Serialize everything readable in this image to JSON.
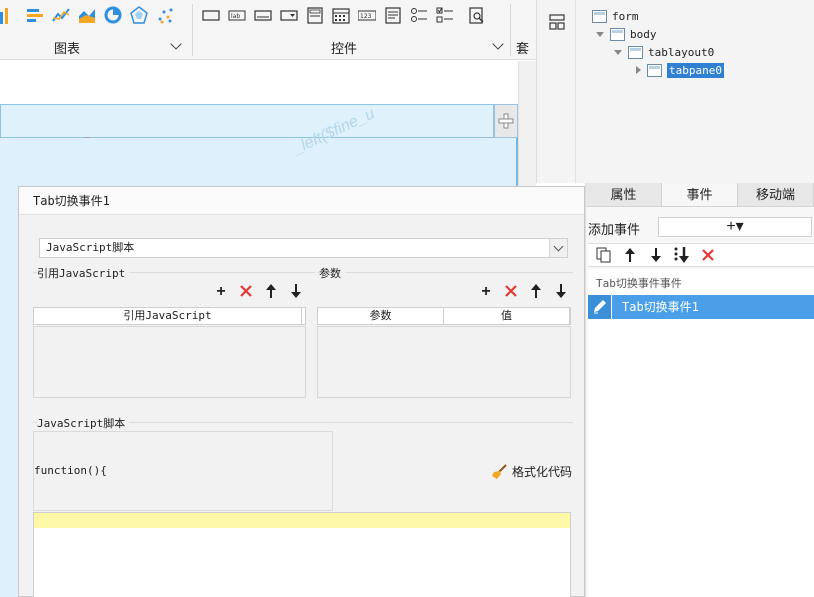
{
  "toolbar": {
    "chart_group_label": "图表",
    "widget_group_label": "控件",
    "partial_label": "套用"
  },
  "canvas": {
    "watermark": "_left($fine_u"
  },
  "tree": {
    "nodes": [
      {
        "label": "form"
      },
      {
        "label": "body"
      },
      {
        "label": "tablayout0"
      },
      {
        "label": "tabpane0"
      }
    ]
  },
  "props": {
    "tabs": [
      {
        "label": "属性"
      },
      {
        "label": "事件"
      },
      {
        "label": "移动端"
      }
    ],
    "add_event_label": "添加事件",
    "add_event_button": "+▾",
    "event_group_label": "Tab切换事件事件",
    "event_item_label": "Tab切换事件1"
  },
  "dialog": {
    "title": "Tab切换事件1",
    "script_type": "JavaScript脚本",
    "ref_js_label": "引用JavaScript",
    "param_label": "参数",
    "ref_js_column": "引用JavaScript",
    "param_columns": [
      "参数",
      "值"
    ],
    "script_section_label": "JavaScript脚本",
    "function_text": "function(){",
    "format_code_label": "格式化代码"
  },
  "colors": {
    "accent": "#4a9fe8",
    "selection": "#2f7fd3",
    "delete": "#e53935",
    "code_highlight": "#fdf8a8"
  }
}
